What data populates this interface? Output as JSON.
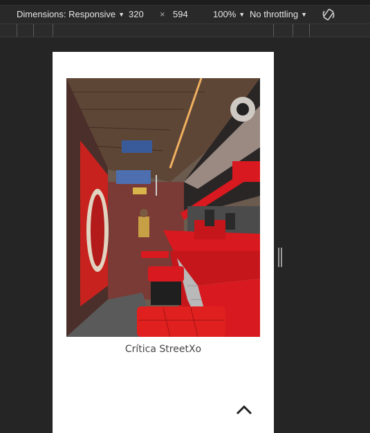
{
  "devtools": {
    "dimensions_label": "Dimensions: Responsive",
    "width_value": "320",
    "times_symbol": "×",
    "height_value": "594",
    "zoom_label": "100%",
    "throttling_label": "No throttling",
    "rotate_icon": "rotate-icon"
  },
  "page": {
    "caption": "Crítica StreetXo",
    "up_icon": "chevron-up-icon"
  },
  "colors": {
    "accent_red": "#d8191f",
    "devtools_bg": "#292929"
  }
}
